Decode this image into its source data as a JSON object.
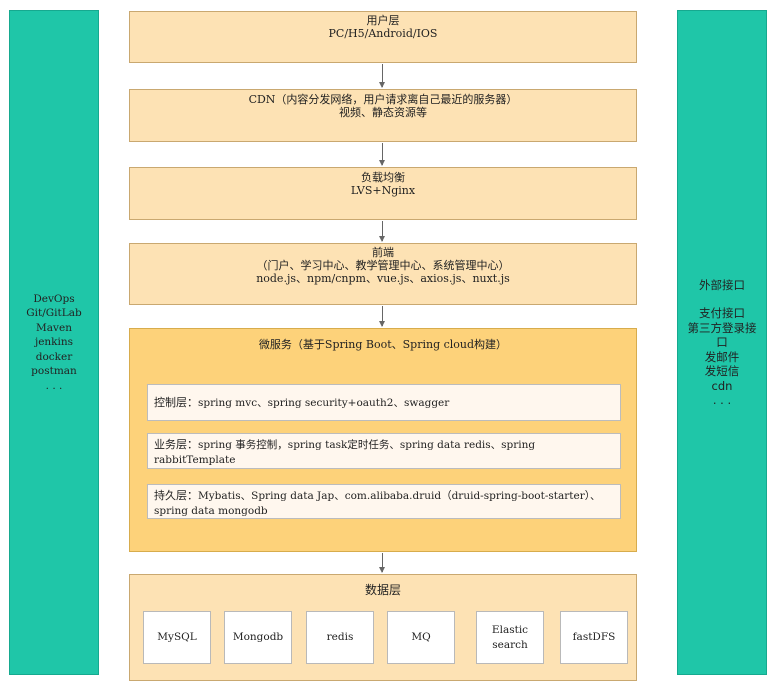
{
  "left_panel": {
    "lines": [
      "DevOps",
      "Git/GitLab",
      "Maven",
      "jenkins",
      "docker",
      "postman",
      ". . ."
    ]
  },
  "right_panel": {
    "title": "外部接口",
    "lines": [
      "支付接口",
      "第三方登录接",
      "口",
      "发邮件",
      "发短信",
      "cdn",
      ". . ."
    ]
  },
  "layers": {
    "user": {
      "title": "用户层",
      "detail": "PC/H5/Android/IOS"
    },
    "cdn": {
      "title": "CDN（内容分发网络，用户请求离自己最近的服务器）",
      "detail": "视频、静态资源等"
    },
    "lb": {
      "title": "负载均衡",
      "detail": "LVS+Nginx"
    },
    "frontend": {
      "title": "前端",
      "subtitle": "（门户、学习中心、教学管理中心、系统管理中心）",
      "detail": "node.js、npm/cnpm、vue.js、axios.js、nuxt.js"
    },
    "microservice": {
      "title": "微服务（基于Spring Boot、Spring cloud构建）",
      "control": {
        "label": "控制层：",
        "text": "spring mvc、spring security+oauth2、swagger"
      },
      "business": {
        "label": "业务层：",
        "text": "spring 事务控制，spring task定时任务、spring data redis、spring rabbitTemplate"
      },
      "persistence": {
        "label": "持久层：",
        "text": "Mybatis、Spring data Jap、com.alibaba.druid（druid-spring-boot-starter）、spring data mongodb"
      }
    },
    "data": {
      "title": "数据层",
      "stores": [
        "MySQL",
        "Mongodb",
        "redis",
        "MQ",
        "Elastic search",
        "fastDFS"
      ]
    }
  },
  "colors": {
    "side_panel": "#1fc6a8",
    "layer_fill": "#fde2b4",
    "microservice_fill": "#fdd27a",
    "sub_fill": "#fff7ee"
  }
}
